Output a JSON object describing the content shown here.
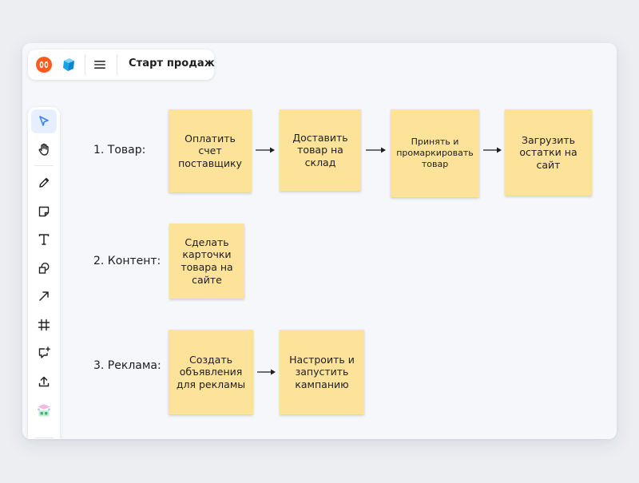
{
  "header": {
    "app_logo_icon": "mts-logo-icon",
    "board_logo_icon": "cube-icon",
    "menu_icon": "hamburger-menu-icon",
    "board_title": "Старт продаж"
  },
  "toolbar": {
    "tools": [
      {
        "name": "select-tool",
        "icon": "cursor-icon",
        "active": true
      },
      {
        "name": "hand-tool",
        "icon": "hand-icon"
      },
      {
        "name": "pen-tool",
        "icon": "pencil-icon"
      },
      {
        "name": "sticky-tool",
        "icon": "sticky-note-icon"
      },
      {
        "name": "text-tool",
        "icon": "text-icon"
      },
      {
        "name": "shapes-tool",
        "icon": "shapes-icon"
      },
      {
        "name": "connector-tool",
        "icon": "arrow-icon"
      },
      {
        "name": "frame-tool",
        "icon": "frame-icon"
      },
      {
        "name": "comment-tool",
        "icon": "comment-add-icon"
      },
      {
        "name": "upload-tool",
        "icon": "upload-icon"
      },
      {
        "name": "templates-tool",
        "icon": "templates-icon"
      }
    ]
  },
  "board": {
    "rows": [
      {
        "label": "1. Товар:",
        "stickies": [
          {
            "text": "Оплатить счет поставщику"
          },
          {
            "text": "Доставить товар на склад"
          },
          {
            "text": "Принять и промаркировать товар"
          },
          {
            "text": "Загрузить остатки на сайт"
          }
        ]
      },
      {
        "label": "2. Контент:",
        "stickies": [
          {
            "text": "Сделать карточки товара на сайте"
          }
        ]
      },
      {
        "label": "3. Реклама:",
        "stickies": [
          {
            "text": "Создать объявления для рекламы"
          },
          {
            "text": "Настроить и запустить кампанию"
          }
        ]
      }
    ],
    "colors": {
      "sticky": "#fde39a",
      "accent": "#3b82f6"
    }
  }
}
